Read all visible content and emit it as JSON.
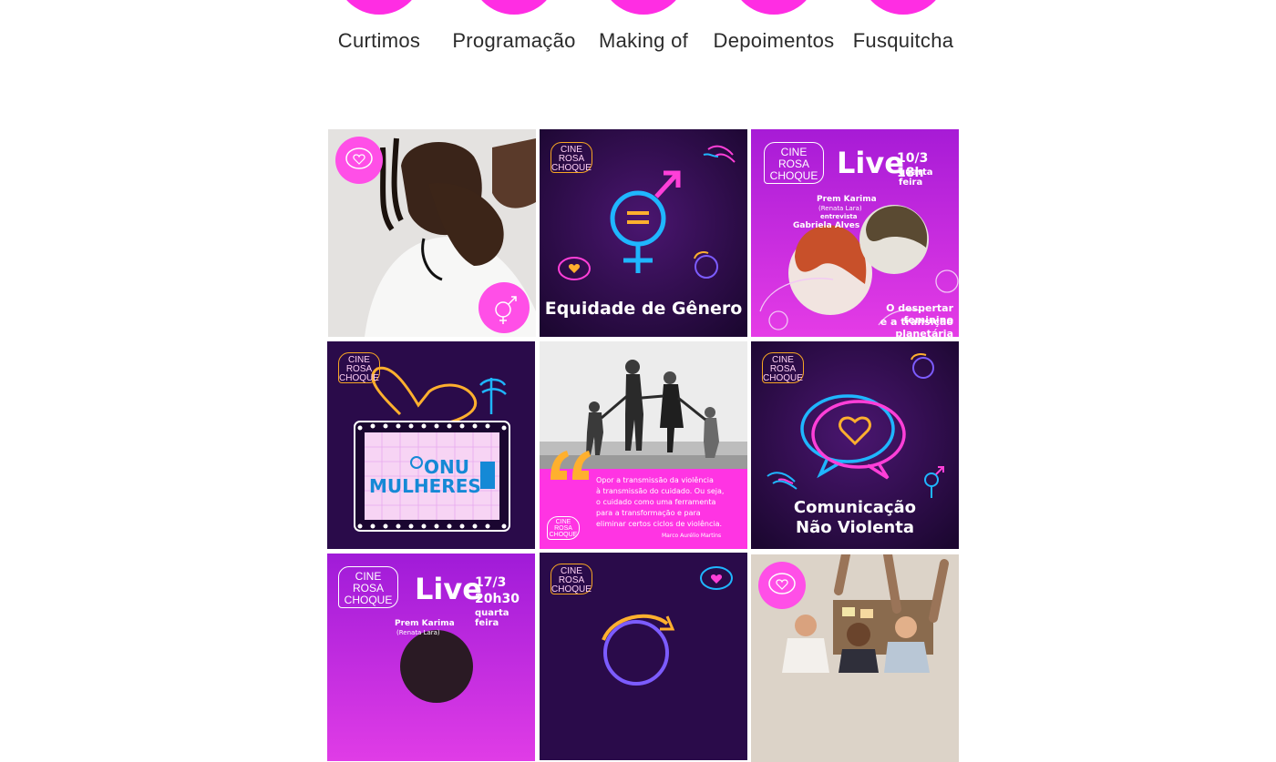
{
  "nav": {
    "items": [
      {
        "label": "Curtimos"
      },
      {
        "label": "Programação"
      },
      {
        "label": "Making of"
      },
      {
        "label": "Depoimentos"
      },
      {
        "label": "Fusquitcha"
      }
    ]
  },
  "colors": {
    "accent": "#ff2de3",
    "purple_dark": "#2a0b4a",
    "magenta": "#d21fe0",
    "pink_light": "#ff5ee8",
    "text": "#2b2b2b"
  },
  "logo": {
    "line1": "CINE",
    "line2": "ROSA",
    "line3": "CHOQUE"
  },
  "tiles": {
    "equidade": {
      "caption": "Equidade de Gênero"
    },
    "live1": {
      "title": "Live",
      "date": "10/3 18h",
      "weekday": "quarta feira",
      "host": "Prem Karima",
      "host_real": "(Renata Lara)",
      "interview": "entrevista",
      "guest": "Gabriela Alves",
      "subtitle1": "O despertar feminino",
      "subtitle2": "e a transição planetária"
    },
    "onu": {
      "line1": "ONU",
      "line2": "MULHERES"
    },
    "quote": {
      "text1": "Opor a transmissão da violência",
      "text2": "à transmissão do cuidado. Ou seja,",
      "text3": "o cuidado como uma ferramenta",
      "text4": "para a transformação e para",
      "text5": "eliminar certos ciclos de violência.",
      "author": "Marco Aurélio Martins"
    },
    "cnv": {
      "line1": "Comunicação",
      "line2": "Não Violenta"
    },
    "live2": {
      "title": "Live",
      "date": "17/3",
      "time": "20h30",
      "weekday": "quarta feira",
      "host": "Prem Karima",
      "host_real": "(Renata Lara)"
    }
  }
}
